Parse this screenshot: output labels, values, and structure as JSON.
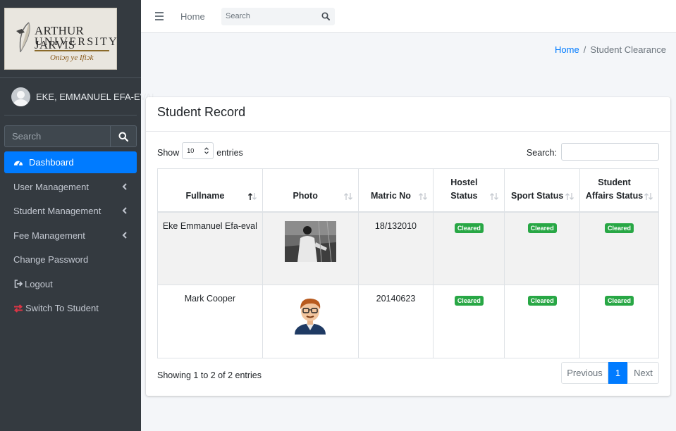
{
  "brand": {
    "logo_line1": "ARTHUR JARVIS",
    "logo_line2": "UNIVERSITY",
    "logo_motto": "Oniɔŋ ye Ifiɔk"
  },
  "user": {
    "name": "EKE, EMMANUEL EFA-EVAL"
  },
  "sidebar": {
    "search_placeholder": "Search",
    "items": [
      {
        "label": "Dashboard",
        "icon": "tachometer-icon",
        "active": true
      },
      {
        "label": "User Management",
        "has_submenu": true
      },
      {
        "label": "Student Management",
        "has_submenu": true
      },
      {
        "label": "Fee Management",
        "has_submenu": true
      },
      {
        "label": "Change Password"
      },
      {
        "label": "Logout",
        "icon": "sign-out-icon"
      },
      {
        "label": "Switch To Student",
        "icon": "exchange-icon"
      }
    ]
  },
  "topbar": {
    "home": "Home",
    "search_placeholder": "Search"
  },
  "breadcrumb": {
    "home": "Home",
    "current": "Student Clearance"
  },
  "card": {
    "title": "Student Record",
    "show_label": "Show",
    "entries_label": "entries",
    "page_length": "10",
    "search_label": "Search:",
    "columns": [
      {
        "line1": "",
        "line2": "Fullname",
        "sorted": "asc"
      },
      {
        "line1": "",
        "line2": "Photo"
      },
      {
        "line1": "",
        "line2": "Matric No"
      },
      {
        "line1": "Hostel",
        "line2": "Status"
      },
      {
        "line1": "",
        "line2": "Sport Status"
      },
      {
        "line1": "Student",
        "line2": "Affairs Status"
      }
    ],
    "rows": [
      {
        "fullname": "Eke Emmanuel Efa-eval",
        "photo": "student-photo",
        "matric": "18/132010",
        "hostel": "Cleared",
        "sport": "Cleared",
        "affairs": "Cleared"
      },
      {
        "fullname": "Mark Cooper",
        "photo": "cartoon-avatar",
        "matric": "20140623",
        "hostel": "Cleared",
        "sport": "Cleared",
        "affairs": "Cleared"
      }
    ],
    "info": "Showing 1 to 2 of 2 entries",
    "pager": {
      "previous": "Previous",
      "page": "1",
      "next": "Next"
    }
  },
  "colors": {
    "sidebar": "#343a40",
    "primary": "#007bff",
    "success": "#28a745",
    "content_bg": "#f4f6f9"
  }
}
